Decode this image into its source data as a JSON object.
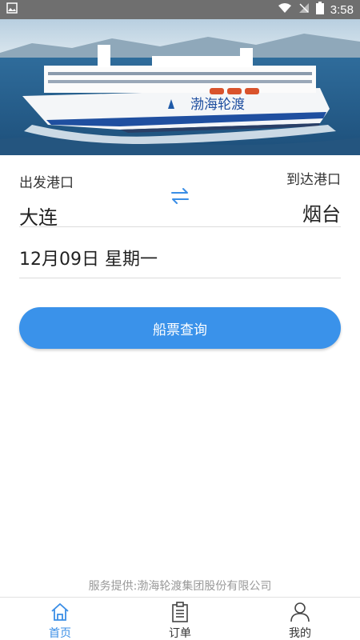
{
  "status_bar": {
    "time": "3:58"
  },
  "route": {
    "from_label": "出发港口",
    "to_label": "到达港口",
    "from_port": "大连",
    "to_port": "烟台"
  },
  "date": {
    "text": "12月09日 星期一"
  },
  "search_button": {
    "label": "船票查询"
  },
  "banner": {
    "ship_name": "渤海轮渡"
  },
  "provider": {
    "text": "服务提供:渤海轮渡集团股份有限公司"
  },
  "tabbar": {
    "items": [
      {
        "label": "首页",
        "icon": "home-icon",
        "active": true
      },
      {
        "label": "订单",
        "icon": "clipboard-icon",
        "active": false
      },
      {
        "label": "我的",
        "icon": "user-icon",
        "active": false
      }
    ]
  },
  "colors": {
    "accent": "#3a92ea",
    "tab_active": "#3a8ee6"
  }
}
